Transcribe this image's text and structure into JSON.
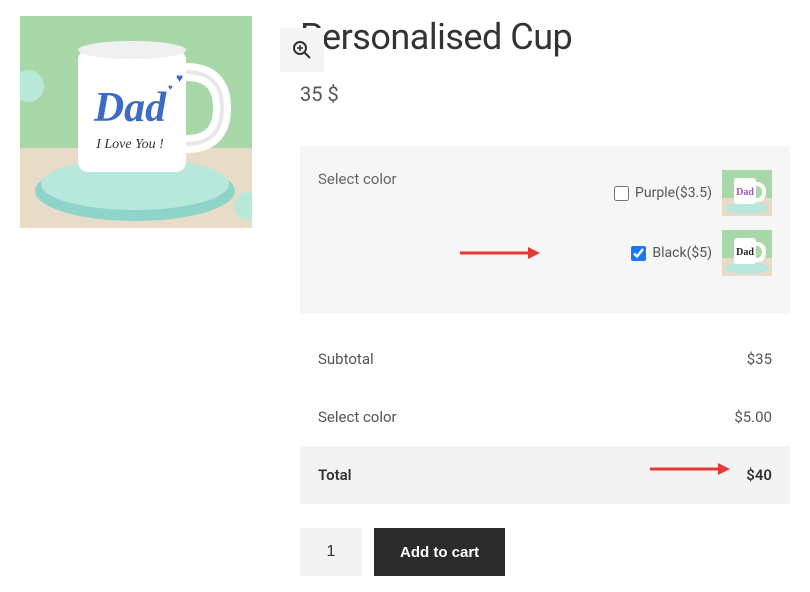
{
  "product": {
    "title": "Personalised Cup",
    "price_value": "35",
    "currency": "$",
    "image_alt": "Dad I Love You mug",
    "mug_script": "Dad",
    "mug_subtext": "I Love You !"
  },
  "options": {
    "label": "Select color",
    "items": [
      {
        "name": "Purple",
        "price": "3.5",
        "checked": false,
        "text_color": "#9b59b6"
      },
      {
        "name": "Black",
        "price": "5",
        "checked": true,
        "text_color": "#222"
      }
    ]
  },
  "summary": {
    "rows": [
      {
        "label": "Subtotal",
        "value": "$35"
      },
      {
        "label": "Select color",
        "value": "$5.00"
      }
    ],
    "total_label": "Total",
    "total_value": "$40"
  },
  "cart": {
    "quantity": "1",
    "button_label": "Add to cart"
  },
  "colors": {
    "accent": "#1976ff"
  }
}
